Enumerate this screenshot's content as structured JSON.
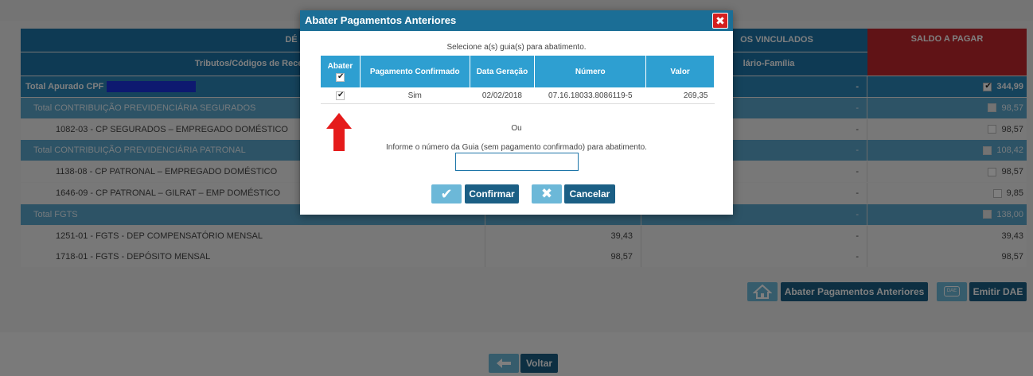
{
  "table": {
    "header_left_partial": "DÉ",
    "header_vinculados_partial": "OS VINCULADOS",
    "header_saldo": "SALDO A PAGAR",
    "subheader_left_partial": "Tributos/Códigos de Receit",
    "subheader_middle_partial": "lário-Família",
    "rows": [
      {
        "kind": "total",
        "label": "Total Apurado CPF",
        "v1": "",
        "v2": "-",
        "v3": "344,99",
        "check": "on"
      },
      {
        "kind": "subtotal",
        "label": "Total CONTRIBUIÇÃO PREVIDENCIÁRIA SEGURADOS",
        "v1": "",
        "v2": "-",
        "v3": "98,57",
        "check": "faint"
      },
      {
        "kind": "item",
        "label": "1082-03 - CP SEGURADOS – EMPREGADO DOMÉSTICO",
        "v1": "",
        "v2": "-",
        "v3": "98,57",
        "check": "off"
      },
      {
        "kind": "subtotal",
        "label": "Total CONTRIBUIÇÃO PREVIDENCIÁRIA PATRONAL",
        "v1": "",
        "v2": "-",
        "v3": "108,42",
        "check": "faint"
      },
      {
        "kind": "item",
        "label": "1138-08 - CP PATRONAL – EMPREGADO DOMÉSTICO",
        "v1": "",
        "v2": "-",
        "v3": "98,57",
        "check": "off"
      },
      {
        "kind": "item",
        "label": "1646-09 - CP PATRONAL – GILRAT – EMP DOMÉSTICO",
        "v1": "",
        "v2": "-",
        "v3": "9,85",
        "check": "off"
      },
      {
        "kind": "subtotal",
        "label": "Total FGTS",
        "v1": "",
        "v2": "-",
        "v3": "138,00",
        "check": "faint"
      },
      {
        "kind": "item",
        "label": "1251-01 - FGTS - DEP COMPENSATÓRIO MENSAL",
        "v1": "39,43",
        "v2": "-",
        "v3": "39,43",
        "check": "none"
      },
      {
        "kind": "item",
        "label": "1718-01 - FGTS - DEPÓSITO MENSAL",
        "v1": "98,57",
        "v2": "-",
        "v3": "98,57",
        "check": "none"
      }
    ]
  },
  "actions": {
    "abater_label": "Abater Pagamentos Anteriores",
    "emitir_label": "Emitir DAE",
    "dae_icon_text": "DAE",
    "voltar_label": "Voltar"
  },
  "modal": {
    "title": "Abater Pagamentos Anteriores",
    "close_symbol": "✖",
    "instruction": "Selecione a(s) guia(s) para abatimento.",
    "columns": [
      "Abater",
      "Pagamento Confirmado",
      "Data Geração",
      "Número",
      "Valor"
    ],
    "rows": [
      {
        "abater": true,
        "pagamento_confirmado": "Sim",
        "data_geracao": "02/02/2018",
        "numero": "07.16.18033.8086119-5",
        "valor": "269,35"
      }
    ],
    "ou": "Ou",
    "inform_text": "Informe o número da Guia (sem pagamento confirmado) para abatimento.",
    "guia_value": "",
    "confirm_label": "Confirmar",
    "cancel_label": "Cancelar"
  },
  "colors": {
    "header_blue": "#1d75a8",
    "saldo_red": "#c0272d",
    "modal_title": "#1b6e96",
    "close_red": "#d51f1f",
    "table_head": "#2e9fd1",
    "arrow_red": "#e51b1b"
  }
}
